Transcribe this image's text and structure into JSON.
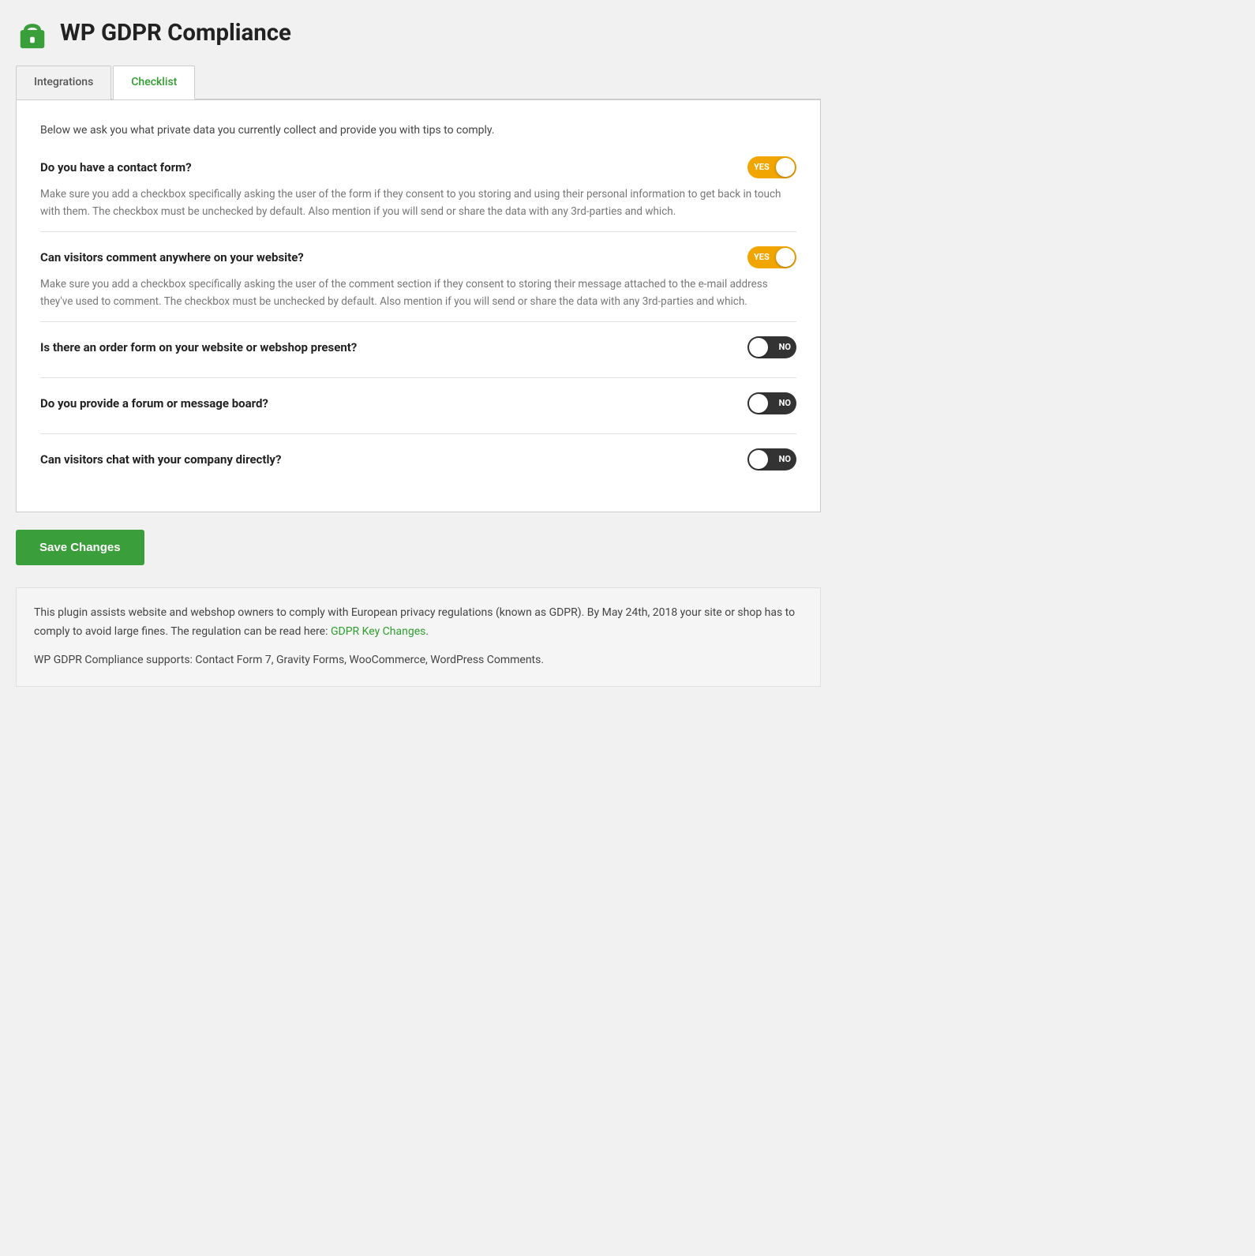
{
  "header": {
    "title": "WP GDPR Compliance",
    "icon_label": "lock-icon"
  },
  "tabs": [
    {
      "id": "integrations",
      "label": "Integrations",
      "active": false
    },
    {
      "id": "checklist",
      "label": "Checklist",
      "active": true
    }
  ],
  "checklist": {
    "intro": "Below we ask you what private data you currently collect and provide you with tips to comply.",
    "questions": [
      {
        "id": "contact-form",
        "label": "Do you have a contact form?",
        "description": "Make sure you add a checkbox specifically asking the user of the form if they consent to you storing and using their personal information to get back in touch with them. The checkbox must be unchecked by default. Also mention if you will send or share the data with any 3rd-parties and which.",
        "toggle_state": "yes",
        "toggle_text_yes": "YES",
        "toggle_text_no": "NO"
      },
      {
        "id": "visitors-comment",
        "label": "Can visitors comment anywhere on your website?",
        "description": "Make sure you add a checkbox specifically asking the user of the comment section if they consent to storing their message attached to the e-mail address they've used to comment. The checkbox must be unchecked by default. Also mention if you will send or share the data with any 3rd-parties and which.",
        "toggle_state": "yes",
        "toggle_text_yes": "YES",
        "toggle_text_no": "NO"
      },
      {
        "id": "order-form",
        "label": "Is there an order form on your website or webshop present?",
        "description": "",
        "toggle_state": "no",
        "toggle_text_yes": "YES",
        "toggle_text_no": "NO"
      },
      {
        "id": "forum",
        "label": "Do you provide a forum or message board?",
        "description": "",
        "toggle_state": "no",
        "toggle_text_yes": "YES",
        "toggle_text_no": "NO"
      },
      {
        "id": "chat",
        "label": "Can visitors chat with your company directly?",
        "description": "",
        "toggle_state": "no",
        "toggle_text_yes": "YES",
        "toggle_text_no": "NO"
      }
    ]
  },
  "save_button": {
    "label": "Save Changes"
  },
  "info_box": {
    "paragraph1_before_link": "This plugin assists website and webshop owners to comply with European privacy regulations (known as GDPR). By May 24th, 2018 your site or shop has to comply to avoid large fines. The regulation can be read here: ",
    "link_text": "GDPR Key Changes",
    "link_href": "#",
    "paragraph1_after_link": ".",
    "paragraph2": "WP GDPR Compliance supports: Contact Form 7, Gravity Forms, WooCommerce, WordPress Comments."
  },
  "colors": {
    "green": "#3a9e3a",
    "toggle_yes": "#f0a500",
    "toggle_no": "#333333"
  }
}
